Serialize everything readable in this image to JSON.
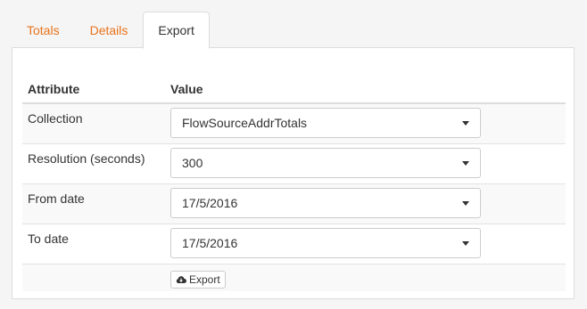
{
  "tabs": [
    {
      "label": "Totals"
    },
    {
      "label": "Details"
    },
    {
      "label": "Export"
    }
  ],
  "active_tab": "Export",
  "accent_color": "#e8731a",
  "table": {
    "headers": {
      "attribute": "Attribute",
      "value": "Value"
    },
    "rows": [
      {
        "label": "Collection",
        "value": "FlowSourceAddrTotals"
      },
      {
        "label": "Resolution (seconds)",
        "value": "300"
      },
      {
        "label": "From date",
        "value": "17/5/2016"
      },
      {
        "label": "To date",
        "value": "17/5/2016"
      }
    ]
  },
  "export_button": {
    "label": "Export",
    "icon": "cloud-download-icon"
  }
}
